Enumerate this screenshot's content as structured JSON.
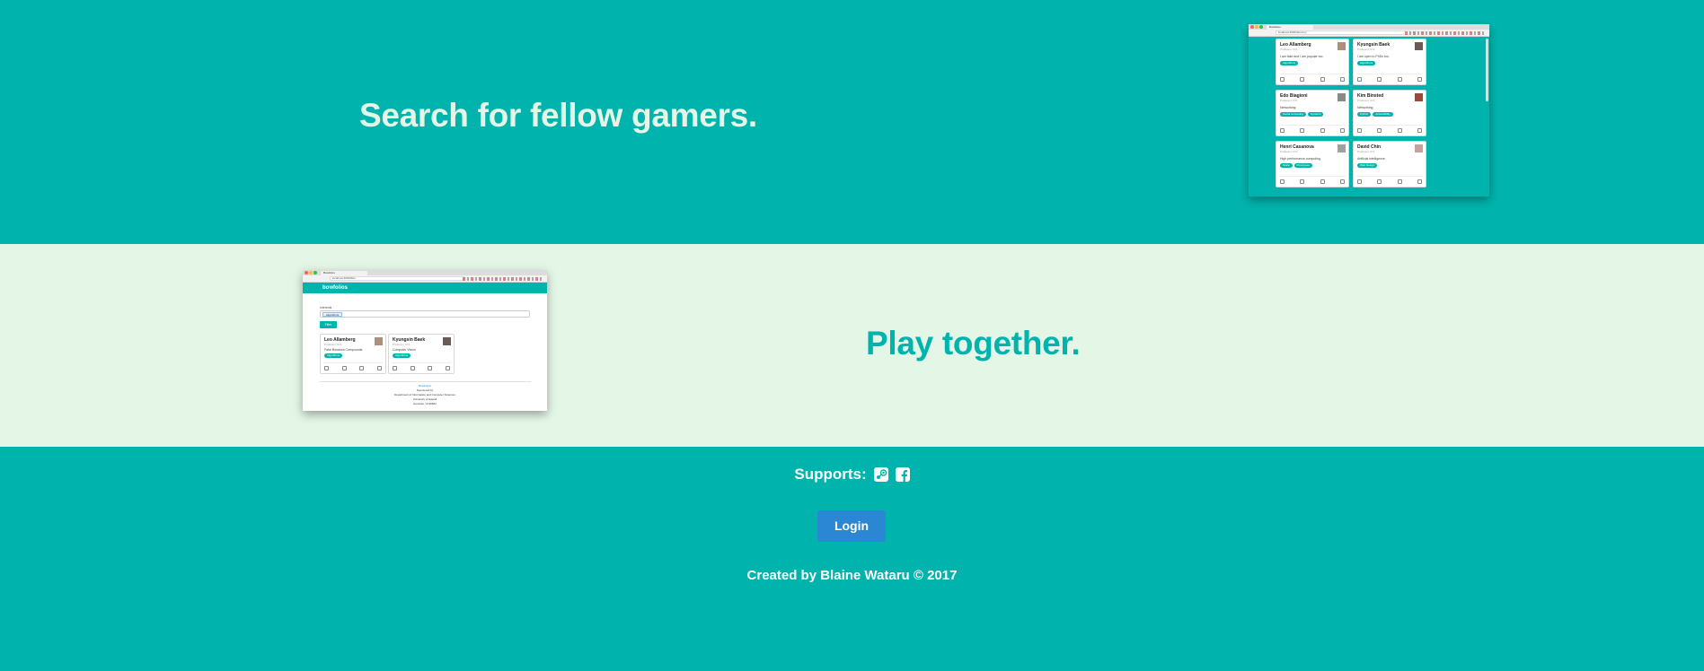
{
  "hero": {
    "headline": "Search for fellow gamers."
  },
  "feature": {
    "headline": "Play together."
  },
  "screenshot_search": {
    "tab_title": "Bowfolios",
    "url": "localhost:3000/directory",
    "cards": [
      {
        "name": "Leo Allamberg",
        "subtitle": "Professor, ICS",
        "desc": "I am fake and I am popular too.",
        "tags": [
          "Algorithms"
        ]
      },
      {
        "name": "Kyungsin Baek",
        "subtitle": "Professor, ICS",
        "desc": "I am open to PhDs too.",
        "tags": [
          "Algorithms"
        ]
      },
      {
        "name": "Edo Biagioni",
        "subtitle": "Professor, ICS",
        "desc": "Networking",
        "tags": [
          "Social computing",
          "Systems"
        ]
      },
      {
        "name": "Kim Binsted",
        "subtitle": "Professor, ICS",
        "desc": "Networking",
        "tags": [
          "Python",
          "Accessibility"
        ]
      },
      {
        "name": "Henri Casanova",
        "subtitle": "Professor, ICS",
        "desc": "High performance computing.",
        "tags": [
          "Scala",
          "Prototypes"
        ]
      },
      {
        "name": "David Chin",
        "subtitle": "Professor, ICS",
        "desc": "Artificial intelligence.",
        "tags": [
          "Web Design"
        ]
      }
    ]
  },
  "screenshot_filter": {
    "tab_title": "Bowfolios",
    "url": "localhost:3000/filter",
    "brand": "bowfolios",
    "interests_label": "Interests",
    "chip": "Algorithms",
    "filter_button": "Filter",
    "cards": [
      {
        "name": "Leo Allamberg",
        "subtitle": "Professor, ICS",
        "desc": "Fake Bonanza Compounds",
        "tags": [
          "Algorithms"
        ]
      },
      {
        "name": "Kyungsin Baek",
        "subtitle": "Professor, ICS",
        "desc": "Computer Vision",
        "tags": [
          "Algorithms"
        ]
      }
    ],
    "footer_lines": [
      "BowFolios",
      "Sponsored by",
      "Department of Information and Computer Sciences",
      "University of Hawaii",
      "Honolulu, HI 96822"
    ]
  },
  "footer": {
    "supports_label": "Supports:",
    "support_icons": [
      "steam-icon",
      "facebook-icon"
    ],
    "login_label": "Login",
    "credit": "Created by Blaine Wataru © 2017"
  },
  "colors": {
    "teal": "#00b4ad",
    "mint": "#e4f7e7",
    "login_blue": "#2b87d3"
  }
}
